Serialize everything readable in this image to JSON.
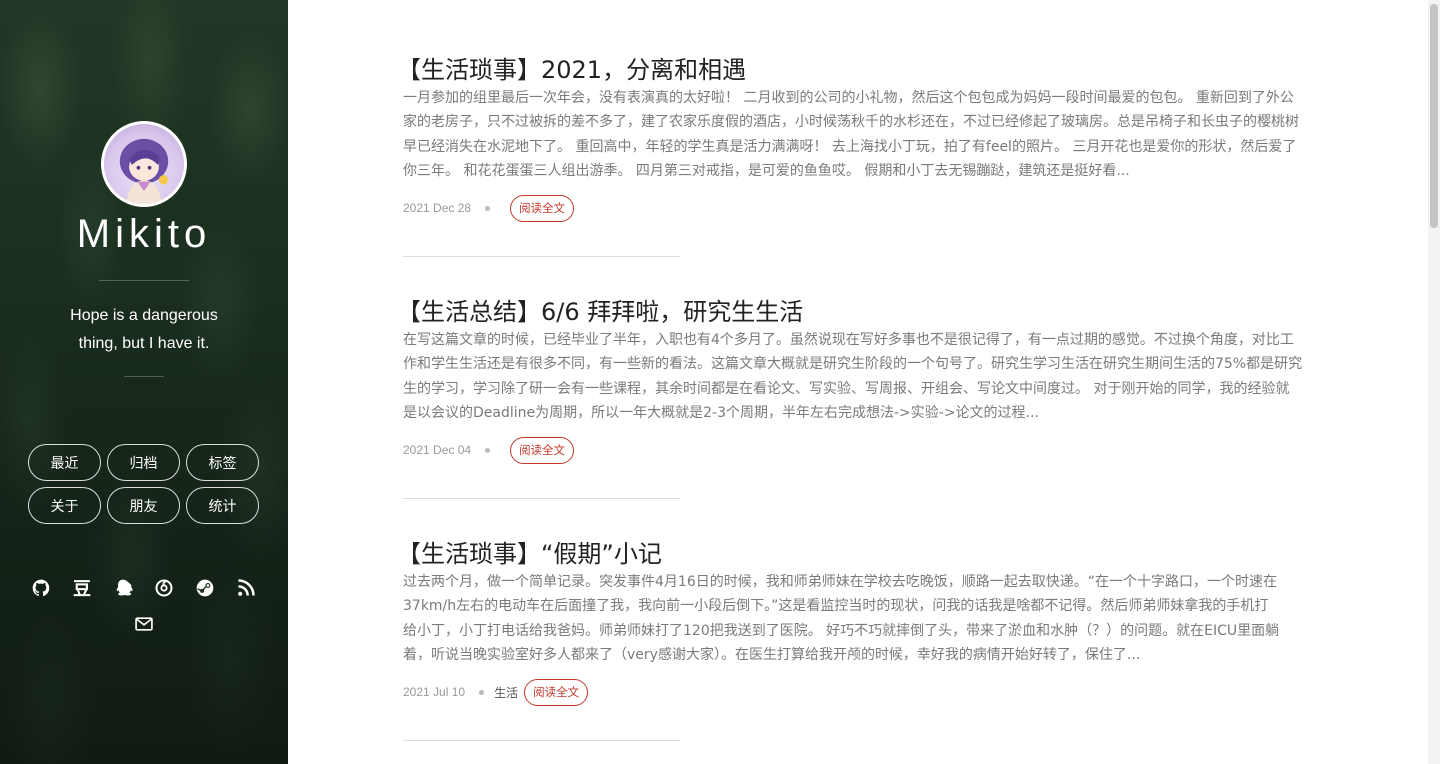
{
  "sidebar": {
    "site_name": "Mikito",
    "motto_line1": "Hope is a dangerous",
    "motto_line2": "thing, but I have it.",
    "nav": [
      "最近",
      "归档",
      "标签",
      "关于",
      "朋友",
      "统计"
    ],
    "social": [
      "github-icon",
      "douban-icon",
      "qq-icon",
      "netease-music-icon",
      "steam-icon",
      "rss-icon",
      "mail-icon"
    ],
    "douban_glyph": "豆"
  },
  "posts": [
    {
      "title": "【生活琐事】2021，分离和相遇",
      "excerpt": [
        "一月参加的组里最后一次年会，没有表演真的太好啦！ 二月收到的公司的小礼物，然后这个包包成为妈妈一段时间最爱的包包。 重新回到了外公",
        "家的老房子，只不过被拆的差不多了，建了农家乐度假的酒店，小时候荡秋千的水杉还在，不过已经修起了玻璃房。总是吊椅子和长虫子的樱桃树",
        "早已经消失在水泥地下了。 重回高中，年轻的学生真是活力满满呀！ 去上海找小丁玩，拍了有feel的照片。 三月开花也是爱你的形状，然后爱了",
        "你三年。 和花花蛋蛋三人组出游季。 四月第三对戒指，是可爱的鱼鱼哎。 假期和小丁去无锡蹦跶，建筑还是挺好看..."
      ],
      "date": "2021 Dec 28",
      "tag": "",
      "read_more": "阅读全文"
    },
    {
      "title": "【生活总结】6/6 拜拜啦，研究生生活",
      "excerpt": [
        "在写这篇文章的时候，已经毕业了半年，入职也有4个多月了。虽然说现在写好多事也不是很记得了，有一点过期的感觉。不过换个角度，对比工",
        "作和学生生活还是有很多不同，有一些新的看法。这篇文章大概就是研究生阶段的一个句号了。研究生学习生活在研究生期间生活的75%都是研究",
        "生的学习，学习除了研一会有一些课程，其余时间都是在看论文、写实验、写周报、开组会、写论文中间度过。 对于刚开始的同学，我的经验就",
        "是以会议的Deadline为周期，所以一年大概就是2-3个周期，半年左右完成想法->实验->论文的过程..."
      ],
      "date": "2021 Dec 04",
      "tag": "",
      "read_more": "阅读全文"
    },
    {
      "title": "【生活琐事】“假期”小记",
      "excerpt": [
        "过去两个月，做一个简单记录。突发事件4月16日的时候，我和师弟师妹在学校去吃晚饭，顺路一起去取快递。“在一个十字路口，一个时速在",
        "37km/h左右的电动车在后面撞了我，我向前一小段后倒下。”这是看监控当时的现状，问我的话我是啥都不记得。然后师弟师妹拿我的手机打",
        "给小丁，小丁打电话给我爸妈。师弟师妹打了120把我送到了医院。 好巧不巧就摔倒了头，带来了淤血和水肿（？）的问题。就在EICU里面躺",
        "着，听说当晚实验室好多人都来了（very感谢大家）。在医生打算给我开颅的时候，幸好我的病情开始好转了，保住了..."
      ],
      "date": "2021 Jul 10",
      "tag": "生活",
      "read_more": "阅读全文"
    }
  ]
}
